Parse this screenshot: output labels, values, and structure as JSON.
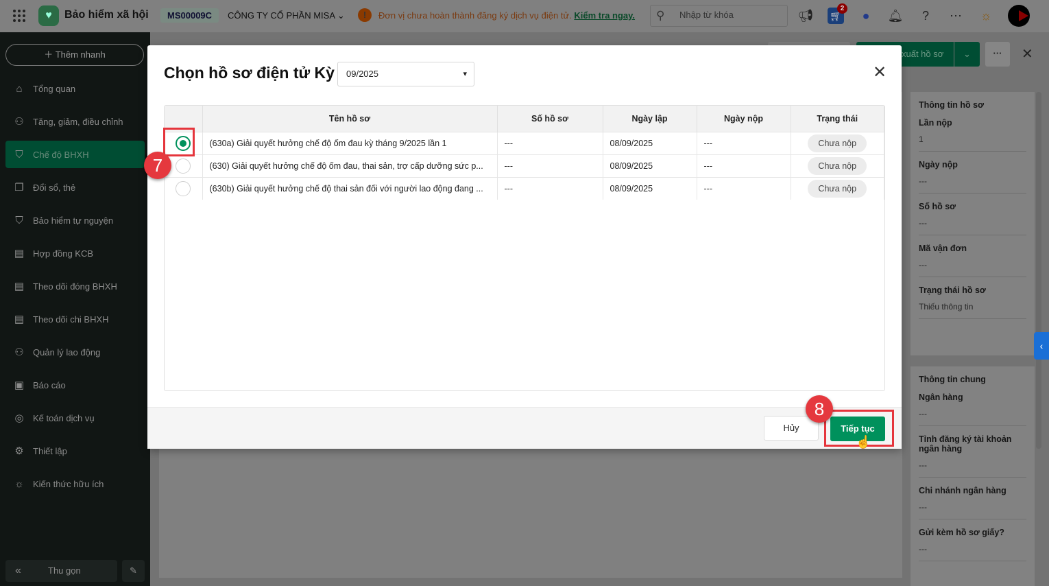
{
  "header": {
    "app_title": "Bảo hiểm xã hội",
    "tax_code": "MS00009C",
    "company": "CÔNG TY CỔ PHẦN MISA",
    "warning": "Đơn vị chưa hoàn thành đăng ký dịch vụ điện tử.",
    "warning_link": "Kiểm tra ngay.",
    "search_placeholder": "Nhập từ khóa",
    "cart_badge": "2"
  },
  "sidebar": {
    "quick_add": "Thêm nhanh",
    "items": [
      {
        "label": "Tổng quan",
        "icon": "⌂"
      },
      {
        "label": "Tăng, giảm, điều chỉnh",
        "icon": "⚇"
      },
      {
        "label": "Chế độ BHXH",
        "icon": "⛉"
      },
      {
        "label": "Đổi sổ, thẻ",
        "icon": "❐"
      },
      {
        "label": "Bảo hiểm tự nguyện",
        "icon": "⛉"
      },
      {
        "label": "Hợp đồng KCB",
        "icon": "▤"
      },
      {
        "label": "Theo dõi đóng BHXH",
        "icon": "▤"
      },
      {
        "label": "Theo dõi chi BHXH",
        "icon": "▤"
      },
      {
        "label": "Quản lý lao động",
        "icon": "⚇"
      },
      {
        "label": "Báo cáo",
        "icon": "▣"
      },
      {
        "label": "Kế toán dịch vụ",
        "icon": "◎"
      },
      {
        "label": "Thiết lập",
        "icon": "⚙"
      },
      {
        "label": "Kiến thức hữu ích",
        "icon": "☼"
      }
    ],
    "collapse": "Thu gọn"
  },
  "toolbar": {
    "export": "xuất hồ sơ"
  },
  "right_panel": {
    "section1": {
      "title": "Thông tin hồ sơ",
      "fields": [
        {
          "label": "Lần nộp",
          "value": "1"
        },
        {
          "label": "Ngày nộp",
          "value": "---"
        },
        {
          "label": "Số hồ sơ",
          "value": "---"
        },
        {
          "label": "Mã vận đơn",
          "value": "---"
        },
        {
          "label": "Trạng thái hồ sơ",
          "value": "Thiếu thông tin"
        }
      ]
    },
    "section2": {
      "title": "Thông tin chung",
      "fields": [
        {
          "label": "Ngân hàng",
          "value": "---"
        },
        {
          "label": "Tỉnh đăng ký tài khoản ngân hàng",
          "value": "---"
        },
        {
          "label": "Chi nhánh ngân hàng",
          "value": "---"
        },
        {
          "label": "Gửi kèm hồ sơ giấy?",
          "value": "---"
        }
      ]
    }
  },
  "dialog": {
    "title": "Chọn hồ sơ điện tử Kỳ",
    "period": "09/2025",
    "columns": [
      "Tên hồ sơ",
      "Số hồ sơ",
      "Ngày lập",
      "Ngày nộp",
      "Trạng thái"
    ],
    "rows": [
      {
        "selected": true,
        "name": "(630a) Giải quyết hưởng chế độ ốm đau kỳ tháng 9/2025 lần 1",
        "number": "---",
        "created": "08/09/2025",
        "submitted": "---",
        "status": "Chưa nộp"
      },
      {
        "selected": false,
        "name": "(630) Giải quyết hưởng chế độ ốm đau, thai sản, trợ cấp dưỡng sức p...",
        "number": "---",
        "created": "08/09/2025",
        "submitted": "---",
        "status": "Chưa nộp"
      },
      {
        "selected": false,
        "name": "(630b) Giải quyết hưởng chế độ thai sản đối với người lao động đang ...",
        "number": "---",
        "created": "08/09/2025",
        "submitted": "---",
        "status": "Chưa nộp"
      }
    ],
    "cancel": "Hủy",
    "next": "Tiếp tục"
  },
  "annotations": {
    "step7": "7",
    "step8": "8",
    "highlight_color": "#e5353c"
  },
  "colors": {
    "primary": "#00915c",
    "sidebar_active": "#004d33"
  }
}
